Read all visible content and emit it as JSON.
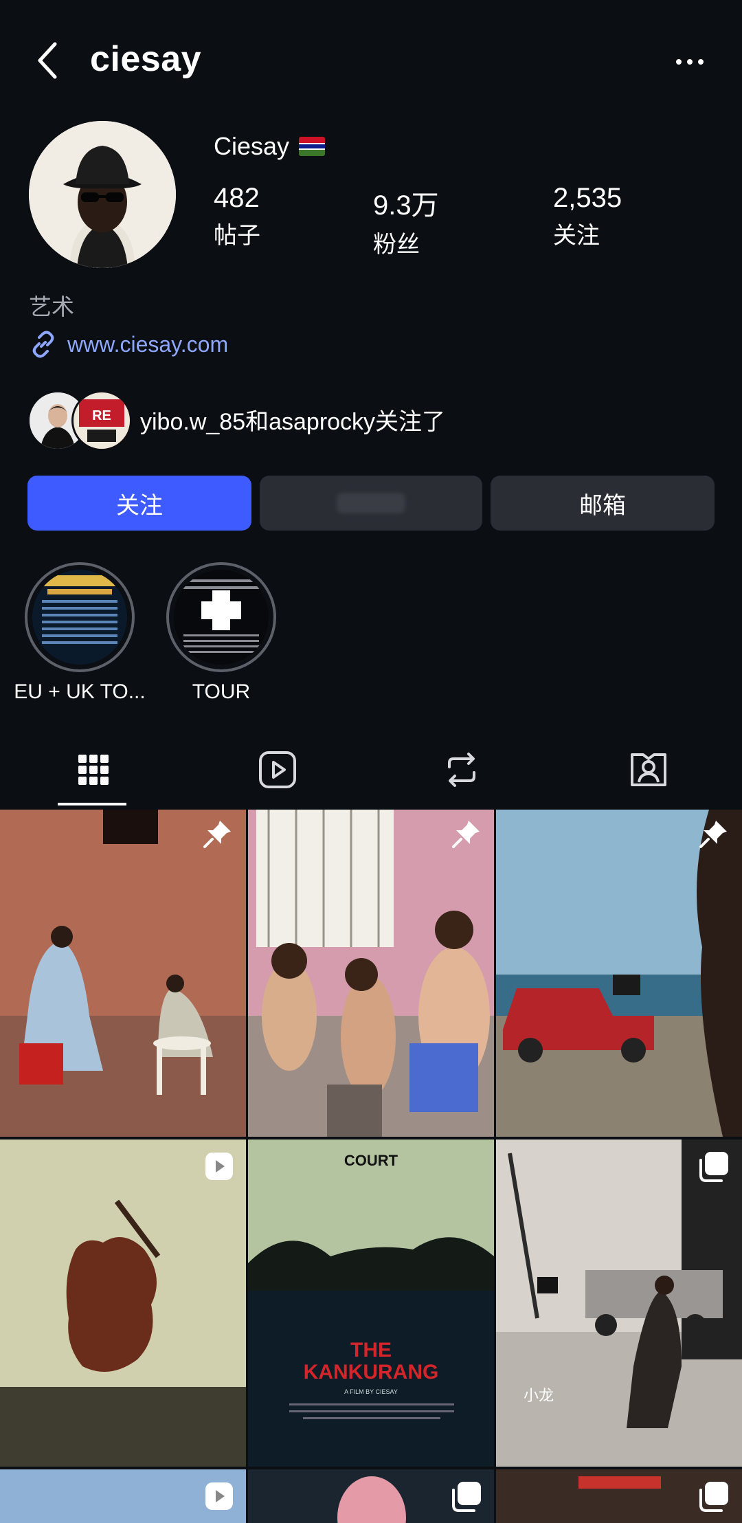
{
  "header": {
    "title": "ciesay",
    "back_icon": "chevron-left-icon",
    "more_icon": "more-dots-icon"
  },
  "profile": {
    "display_name": "Ciesay",
    "flag_icon": "gambia-flag-icon",
    "stats": [
      {
        "value": "482",
        "label": "帖子"
      },
      {
        "value": "9.3万",
        "label": "粉丝"
      },
      {
        "value": "2,535",
        "label": "关注"
      }
    ],
    "category": "艺术",
    "website": "www.ciesay.com"
  },
  "followed_by": {
    "text": "yibo.w_85和asaprocky关注了"
  },
  "buttons": {
    "follow": "关注",
    "message": "",
    "email": "邮箱"
  },
  "colors": {
    "background": "#0b0e13",
    "accent": "#3d5bff",
    "button_secondary": "#2a2d34",
    "link": "#8ea7ff"
  },
  "highlights": [
    {
      "label": "EU + UK TO..."
    },
    {
      "label": "TOUR"
    }
  ],
  "tabs": [
    {
      "name": "posts-grid-icon",
      "selected": true
    },
    {
      "name": "reels-icon",
      "selected": false
    },
    {
      "name": "reposts-icon",
      "selected": false
    },
    {
      "name": "tagged-icon",
      "selected": false
    }
  ],
  "posts": [
    {
      "badge": "pin-icon"
    },
    {
      "badge": "pin-icon"
    },
    {
      "badge": "pin-icon"
    },
    {
      "badge": "reel-icon"
    },
    {
      "badge": "",
      "poster_title": "THE\nKANKURANG",
      "poster_top": "COURT",
      "poster_sub": "A FILM BY CIESAY"
    },
    {
      "badge": "carousel-icon",
      "caption_overlay": "小龙"
    },
    {
      "badge": "reel-icon"
    },
    {
      "badge": "carousel-icon"
    },
    {
      "badge": "carousel-icon"
    }
  ]
}
